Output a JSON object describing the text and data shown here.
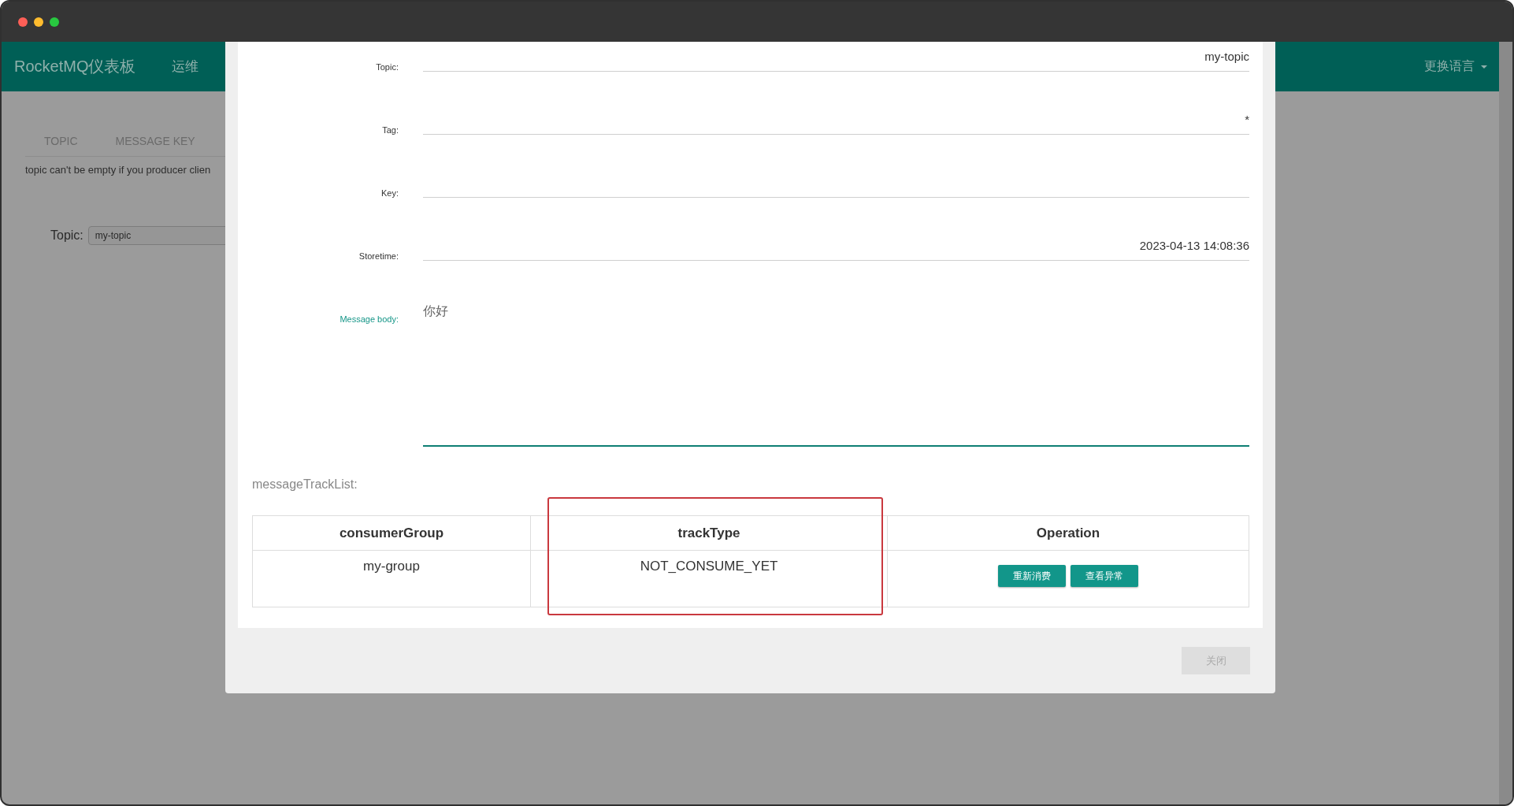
{
  "window": {
    "controls": [
      {
        "color": "#fe5f57"
      },
      {
        "color": "#febc2e"
      },
      {
        "color": "#28c840"
      }
    ]
  },
  "navbar": {
    "brand": "RocketMQ仪表板",
    "items": [
      "运维"
    ],
    "language_menu": "更换语言"
  },
  "page": {
    "tabs": [
      {
        "label": "TOPIC",
        "selected": false
      },
      {
        "label": "MESSAGE KEY",
        "selected": false
      }
    ],
    "hint": "topic can't be empty if you producer clien",
    "topic_label": "Topic:",
    "topic_value": "my-topic"
  },
  "dialog": {
    "fields": [
      {
        "label": "Topic:",
        "value": "my-topic"
      },
      {
        "label": "Tag:",
        "value": "*"
      },
      {
        "label": "Key:"
      },
      {
        "label": "Storetime:",
        "value": "2023-04-13 14:08:36"
      }
    ],
    "body_label": "Message body:",
    "body": "你好",
    "track_title": "messageTrackList:",
    "table": {
      "columns": [
        {
          "label": "consumerGroup",
          "highlighted": false
        },
        {
          "label": "trackType",
          "highlighted": true
        },
        {
          "label": "Operation",
          "highlighted": false
        }
      ],
      "rows": [
        {
          "consumerGroup": "my-group",
          "trackType": "NOT_CONSUME_YET",
          "actions": [
            "重新消费",
            "查看异常"
          ]
        }
      ]
    },
    "close_button": {
      "label": "关闭",
      "disabled": true
    }
  }
}
